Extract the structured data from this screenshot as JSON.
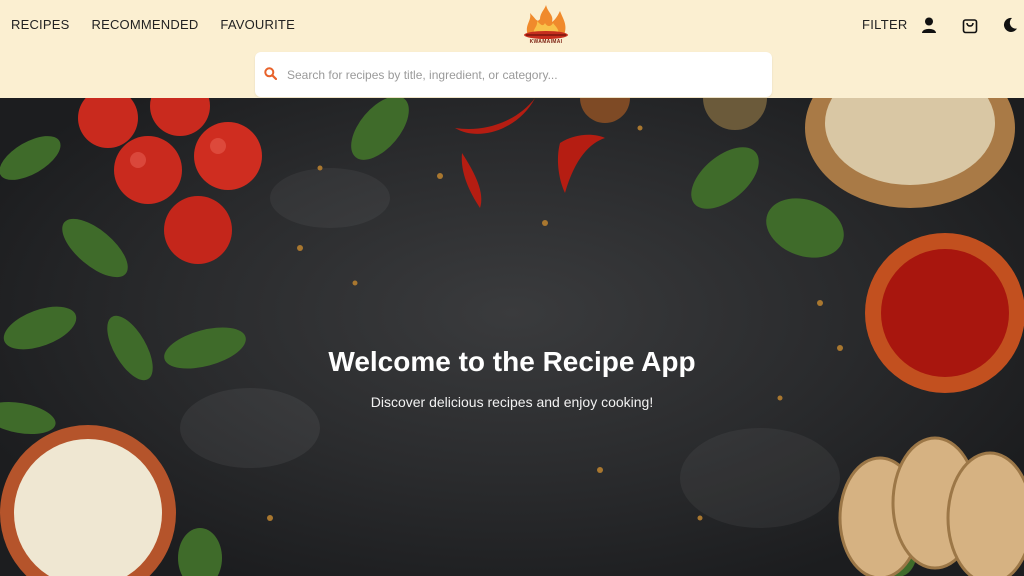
{
  "nav": {
    "left_links": [
      "RECIPES",
      "RECOMMENDED",
      "FAVOURITE"
    ],
    "filter_label": "FILTER"
  },
  "logo": {
    "text": "KWAMAIMAI"
  },
  "icons": {
    "user": "user-icon",
    "bag": "shopping-bag-icon",
    "theme": "moon-icon",
    "search": "search-icon"
  },
  "search": {
    "placeholder": "Search for recipes by title, ingredient, or category...",
    "value": ""
  },
  "hero": {
    "title": "Welcome to the Recipe App",
    "subtitle": "Discover delicious recipes and enjoy cooking!"
  },
  "colors": {
    "header_bg": "#fbefd1",
    "accent": "#e8622a",
    "hero_bg": "#2a2b2d"
  }
}
